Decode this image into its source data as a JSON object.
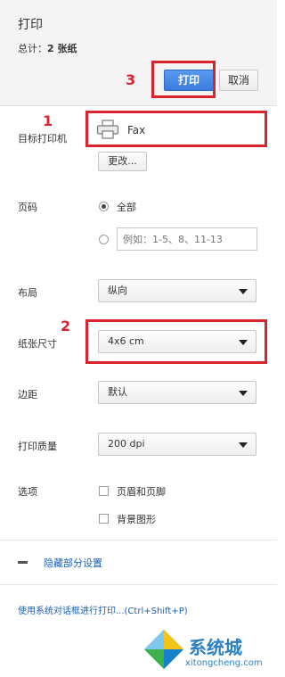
{
  "header": {
    "title": "打印",
    "total_prefix": "总计：",
    "total_value": "2 张纸",
    "print_label": "打印",
    "cancel_label": "取消"
  },
  "annotations": [
    "1",
    "2",
    "3"
  ],
  "destination": {
    "label": "目标打印机",
    "printer_name": "Fax",
    "change_label": "更改..."
  },
  "pages": {
    "label": "页码",
    "all_label": "全部",
    "custom_placeholder": "例如：1-5、8、11-13"
  },
  "layout": {
    "label": "布局",
    "value": "纵向"
  },
  "paper_size": {
    "label": "纸张尺寸",
    "value": "4x6 cm"
  },
  "margins": {
    "label": "边距",
    "value": "默认"
  },
  "quality": {
    "label": "打印质量",
    "value": "200 dpi"
  },
  "options": {
    "label": "选项",
    "headers_footers": "页眉和页脚",
    "background_graphics": "背景图形"
  },
  "less_settings": {
    "icon": "minus-icon",
    "label": "隐藏部分设置"
  },
  "system_dialog": {
    "label": "使用系统对话框进行打印...(Ctrl+Shift+P)"
  },
  "watermark": {
    "brand": "系统城",
    "url": "xitongcheng.com"
  },
  "colors": {
    "accent": "#3a7be0",
    "annotation": "#d9232d",
    "link": "#1a5fb4"
  }
}
